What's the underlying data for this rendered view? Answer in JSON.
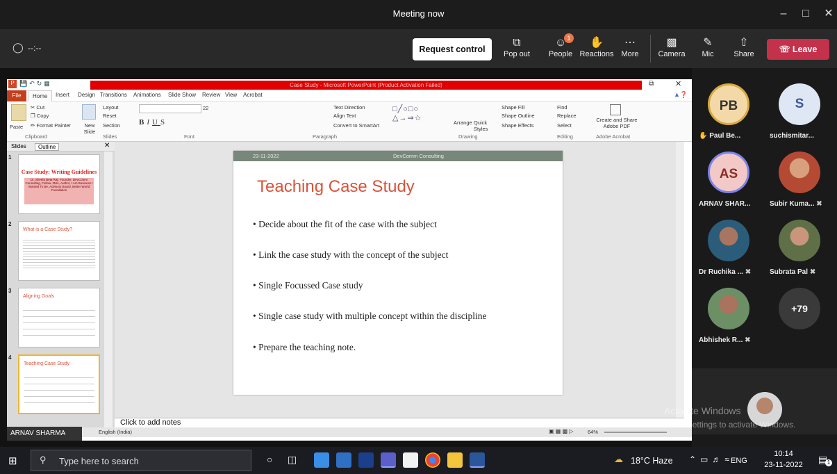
{
  "window": {
    "title": "Meeting now"
  },
  "meeting": {
    "timer": "--:--",
    "request_control": "Request control",
    "toolbar": [
      {
        "label": "Pop out",
        "icon": "pop-out-icon"
      },
      {
        "label": "People",
        "icon": "people-icon",
        "badge": "1"
      },
      {
        "label": "Reactions",
        "icon": "reactions-icon"
      },
      {
        "label": "More",
        "icon": "more-icon"
      },
      {
        "label": "Camera",
        "icon": "camera-off-icon"
      },
      {
        "label": "Mic",
        "icon": "mic-off-icon"
      },
      {
        "label": "Share",
        "icon": "share-icon"
      }
    ],
    "leave": "Leave"
  },
  "powerpoint": {
    "title": "Case Study - Microsoft PowerPoint (Product Activation Failed)",
    "tabs": [
      "File",
      "Home",
      "Insert",
      "Design",
      "Transitions",
      "Animations",
      "Slide Show",
      "Review",
      "View",
      "Acrobat"
    ],
    "ribbon": {
      "clipboard": {
        "paste": "Paste",
        "cut": "Cut",
        "copy": "Copy",
        "format_painter": "Format Painter",
        "group": "Clipboard"
      },
      "slides": {
        "new_slide": "New Slide",
        "layout": "Layout",
        "reset": "Reset",
        "section": "Section",
        "group": "Slides"
      },
      "font": {
        "size": "22",
        "group": "Font"
      },
      "paragraph": {
        "text_direction": "Text Direction",
        "align_text": "Align Text",
        "convert_smartart": "Convert to SmartArt",
        "group": "Paragraph"
      },
      "drawing": {
        "arrange": "Arrange",
        "quick_styles": "Quick Styles",
        "shape_fill": "Shape Fill",
        "shape_outline": "Shape Outline",
        "shape_effects": "Shape Effects",
        "group": "Drawing"
      },
      "editing": {
        "find": "Find",
        "replace": "Replace",
        "select": "Select",
        "group": "Editing"
      },
      "acrobat": {
        "create_share": "Create and Share Adobe PDF",
        "group": "Adobe Acrobat"
      }
    },
    "pane_tabs": [
      "Slides",
      "Outline"
    ],
    "thumbnails": [
      {
        "num": "1",
        "title": "Case Study: Writing Guidelines",
        "body": "Dr. Sheela Beta Raj, Founder, DevComm Consulting, Fellow, IIMA, Author, I Am Business I Wanted To Be, Advisory Board, Better World Foundation"
      },
      {
        "num": "2",
        "title": "What is a Case Study?"
      },
      {
        "num": "3",
        "title": "Aligning Goals"
      },
      {
        "num": "4",
        "title": "Teaching Case Study"
      }
    ],
    "slide": {
      "date": "23-11-2022",
      "org": "DevComm Consulting",
      "title": "Teaching Case Study",
      "bullets": [
        "Decide about the fit of the case with the subject",
        "Link the case study with the concept of the subject",
        "Single Focussed Case study",
        "Single case study with multiple concept within the discipline",
        "Prepare the teaching note."
      ]
    },
    "notes_placeholder": "Click to add notes",
    "status_lang": "English (India)",
    "zoom": "64%",
    "presenter_tag": "ARNAV SHARMA"
  },
  "participants": [
    {
      "initials": "PB",
      "name": "Paul Be...",
      "color": "#f3d9a8",
      "ring": "#d8a93d",
      "text": "#333",
      "raised_hand": true
    },
    {
      "initials": "S",
      "name": "suchismitar...",
      "color": "#dfe6f4",
      "ring": "#dfe6f4",
      "text": "#3a5a96"
    },
    {
      "initials": "AS",
      "name": "ARNAV SHAR...",
      "color": "#f2c9c6",
      "ring": "#7b83eb",
      "text": "#8a2e26"
    },
    {
      "initials": "",
      "name": "Subir Kuma...",
      "color": "#c88a6b",
      "ring": "#c88a6b",
      "text": "#fff",
      "photo": true
    },
    {
      "initials": "",
      "name": "Dr Ruchika ...",
      "color": "#8a5b4a",
      "ring": "#8a5b4a",
      "text": "#fff",
      "photo": true
    },
    {
      "initials": "",
      "name": "Subrata Pal",
      "color": "#6d7a55",
      "ring": "#6d7a55",
      "text": "#fff",
      "photo": true
    },
    {
      "initials": "",
      "name": "Abhishek R...",
      "color": "#5f7a62",
      "ring": "#5f7a62",
      "text": "#fff",
      "photo": true
    },
    {
      "initials": "+79",
      "name": "",
      "color": "#3a3a3a",
      "ring": "#3a3a3a",
      "text": "#fff"
    }
  ],
  "watermark": {
    "line1": "Activate Windows",
    "line2": "Go to Settings to activate Windows."
  },
  "taskbar": {
    "search_placeholder": "Type here to search",
    "weather": "18°C Haze",
    "lang": "ENG",
    "time": "10:14",
    "date": "23-11-2022",
    "notification_count": "1"
  }
}
